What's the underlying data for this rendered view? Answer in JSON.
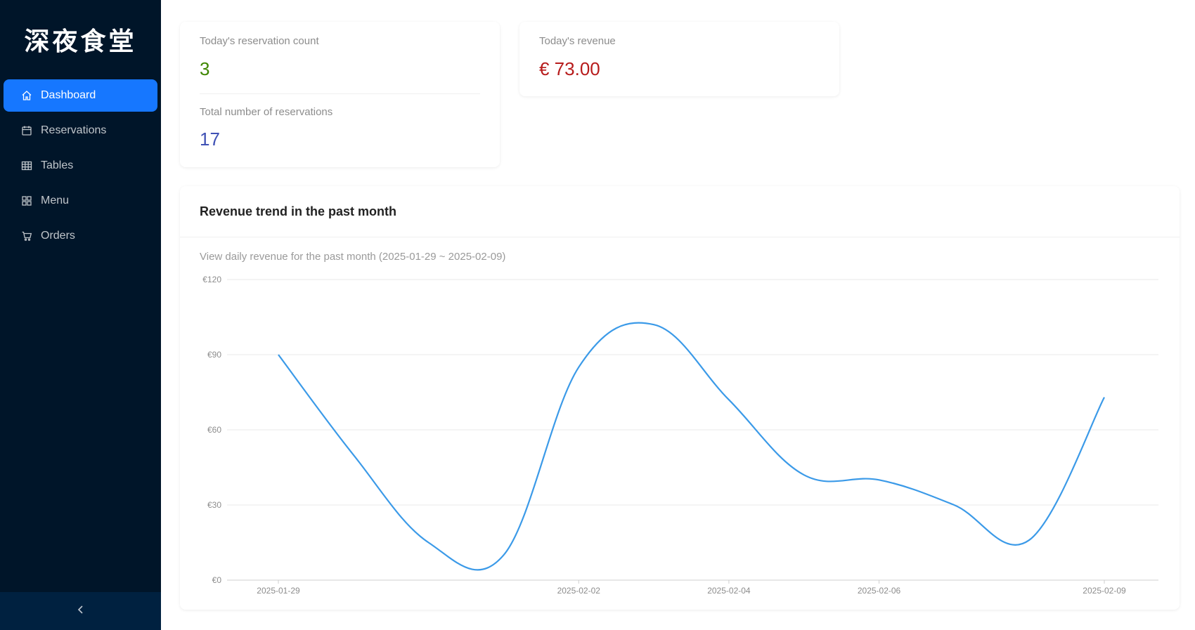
{
  "sidebar": {
    "logo": "深夜食堂",
    "items": [
      {
        "label": "Dashboard",
        "icon": "home-icon",
        "active": true
      },
      {
        "label": "Reservations",
        "icon": "calendar-icon",
        "active": false
      },
      {
        "label": "Tables",
        "icon": "table-icon",
        "active": false
      },
      {
        "label": "Menu",
        "icon": "appstore-icon",
        "active": false
      },
      {
        "label": "Orders",
        "icon": "cart-icon",
        "active": false
      }
    ],
    "collapse_icon": "chevron-left-icon"
  },
  "stats": {
    "today_count_label": "Today's reservation count",
    "today_count_value": "3",
    "total_label": "Total number of reservations",
    "total_value": "17",
    "revenue_label": "Today's revenue",
    "revenue_value": "€ 73.00"
  },
  "colors": {
    "sidebar_bg": "#001529",
    "active": "#1677ff",
    "count_green": "#3f8600",
    "total_blue": "#3f51b5",
    "revenue_red": "#b71c1c",
    "line": "#3b9ae8"
  },
  "chart_card": {
    "title": "Revenue trend in the past month",
    "description": "View daily revenue for the past month (2025-01-29 ~ 2025-02-09)"
  },
  "chart_data": {
    "type": "line",
    "x": [
      "2025-01-29",
      "2025-01-30",
      "2025-01-31",
      "2025-02-01",
      "2025-02-02",
      "2025-02-03",
      "2025-02-04",
      "2025-02-05",
      "2025-02-06",
      "2025-02-07",
      "2025-02-08",
      "2025-02-09"
    ],
    "values": [
      90,
      50,
      15,
      10,
      85,
      102,
      72,
      42,
      40,
      30,
      16,
      73
    ],
    "ylim": [
      0,
      120
    ],
    "yticks": [
      "€0",
      "€30",
      "€60",
      "€90",
      "€120"
    ],
    "ytick_values": [
      0,
      30,
      60,
      90,
      120
    ],
    "xtick_labels": [
      "2025-01-29",
      "2025-02-02",
      "2025-02-04",
      "2025-02-06",
      "2025-02-09"
    ],
    "grid": true
  }
}
